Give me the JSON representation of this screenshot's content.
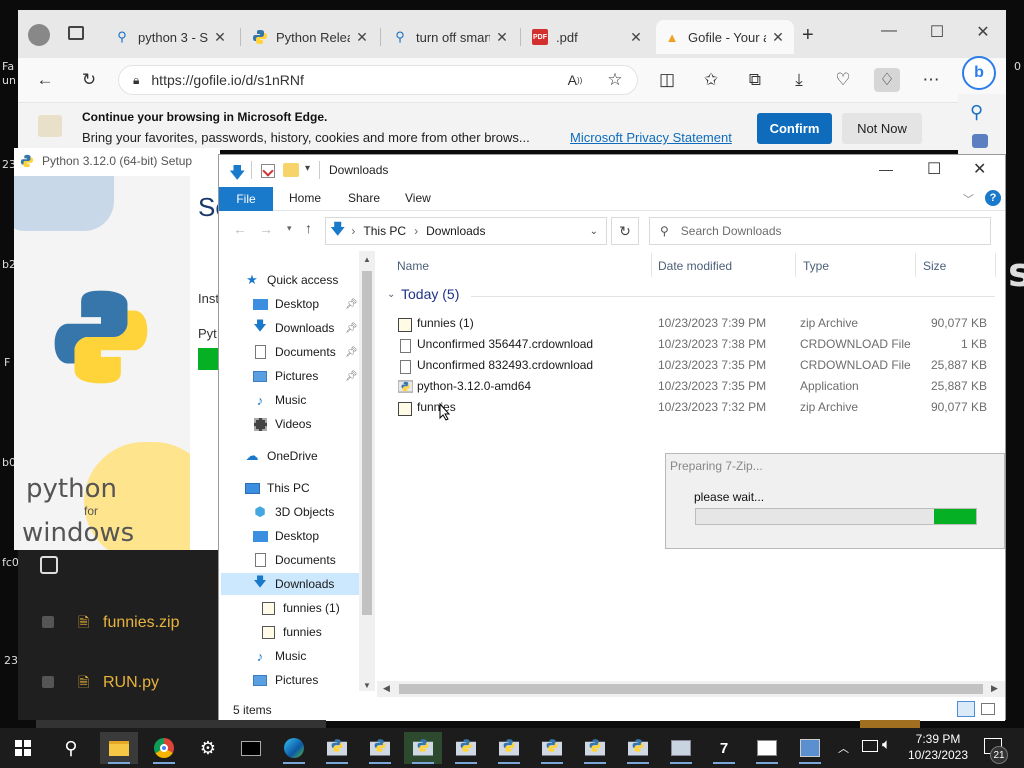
{
  "desktop": {
    "edge_left": [
      "Fa",
      "un",
      "23",
      "b2",
      "F",
      "b0",
      "fc0",
      "23"
    ],
    "edge_right": [
      "0",
      "s"
    ]
  },
  "browser": {
    "tabs": [
      {
        "title": "python 3 - Se",
        "icon": "search-icon"
      },
      {
        "title": "Python Releas",
        "icon": "python-icon"
      },
      {
        "title": "turn off smart",
        "icon": "search-icon"
      },
      {
        "title": ".pdf",
        "icon": "pdf-icon"
      },
      {
        "title": "Gofile - Your a",
        "icon": "gofile-icon"
      }
    ],
    "url": "https://gofile.io/d/s1nRNf",
    "infobar": {
      "title": "Continue your browsing in Microsoft Edge.",
      "message": "Bring your favorites, passwords, history, cookies and more from other brows...",
      "link": "Microsoft Privacy Statement",
      "confirm": "Confirm",
      "not_now": "Not Now"
    }
  },
  "pysetup": {
    "title": "Python 3.12.0 (64-bit) Setup",
    "heading": "Se",
    "inst": "Inst",
    "pyt": "Pyt",
    "brand1": "python",
    "brand2": "for",
    "brand3": "windows"
  },
  "sitefiles": [
    {
      "name": "funnies.zip"
    },
    {
      "name": "RUN.py"
    }
  ],
  "explorer": {
    "title": "Downloads",
    "ribbon": [
      "File",
      "Home",
      "Share",
      "View"
    ],
    "path": [
      "This PC",
      "Downloads"
    ],
    "search_placeholder": "Search Downloads",
    "nav": {
      "quick_access": "Quick access",
      "qa_items": [
        "Desktop",
        "Downloads",
        "Documents",
        "Pictures",
        "Music",
        "Videos"
      ],
      "onedrive": "OneDrive",
      "this_pc": "This PC",
      "pc_items": [
        "3D Objects",
        "Desktop",
        "Documents",
        "Downloads",
        "funnies (1)",
        "funnies",
        "Music",
        "Pictures"
      ]
    },
    "columns": [
      "Name",
      "Date modified",
      "Type",
      "Size"
    ],
    "group": "Today (5)",
    "files": [
      {
        "name": "funnies (1)",
        "date": "10/23/2023 7:39 PM",
        "type": "zip Archive",
        "size": "90,077 KB"
      },
      {
        "name": "Unconfirmed 356447.crdownload",
        "date": "10/23/2023 7:38 PM",
        "type": "CRDOWNLOAD File",
        "size": "1 KB"
      },
      {
        "name": "Unconfirmed 832493.crdownload",
        "date": "10/23/2023 7:35 PM",
        "type": "CRDOWNLOAD File",
        "size": "25,887 KB"
      },
      {
        "name": "python-3.12.0-amd64",
        "date": "10/23/2023 7:35 PM",
        "type": "Application",
        "size": "25,887 KB"
      },
      {
        "name": "funnies",
        "date": "10/23/2023 7:32 PM",
        "type": "zip Archive",
        "size": "90,077 KB"
      }
    ],
    "status": "5 items"
  },
  "zipdlg": {
    "title": "Preparing 7-Zip...",
    "message": "please wait...",
    "progress": 0.15
  },
  "taskbar": {
    "time": "7:39 PM",
    "date": "10/23/2023",
    "notif_count": "21"
  },
  "colors": {
    "accent": "#0f6cbd",
    "file_tab": "#1979ca",
    "selection": "#cce8ff",
    "progress_green": "#06b025",
    "python_yellow": "#ffd43b",
    "python_blue": "#3776ab"
  }
}
